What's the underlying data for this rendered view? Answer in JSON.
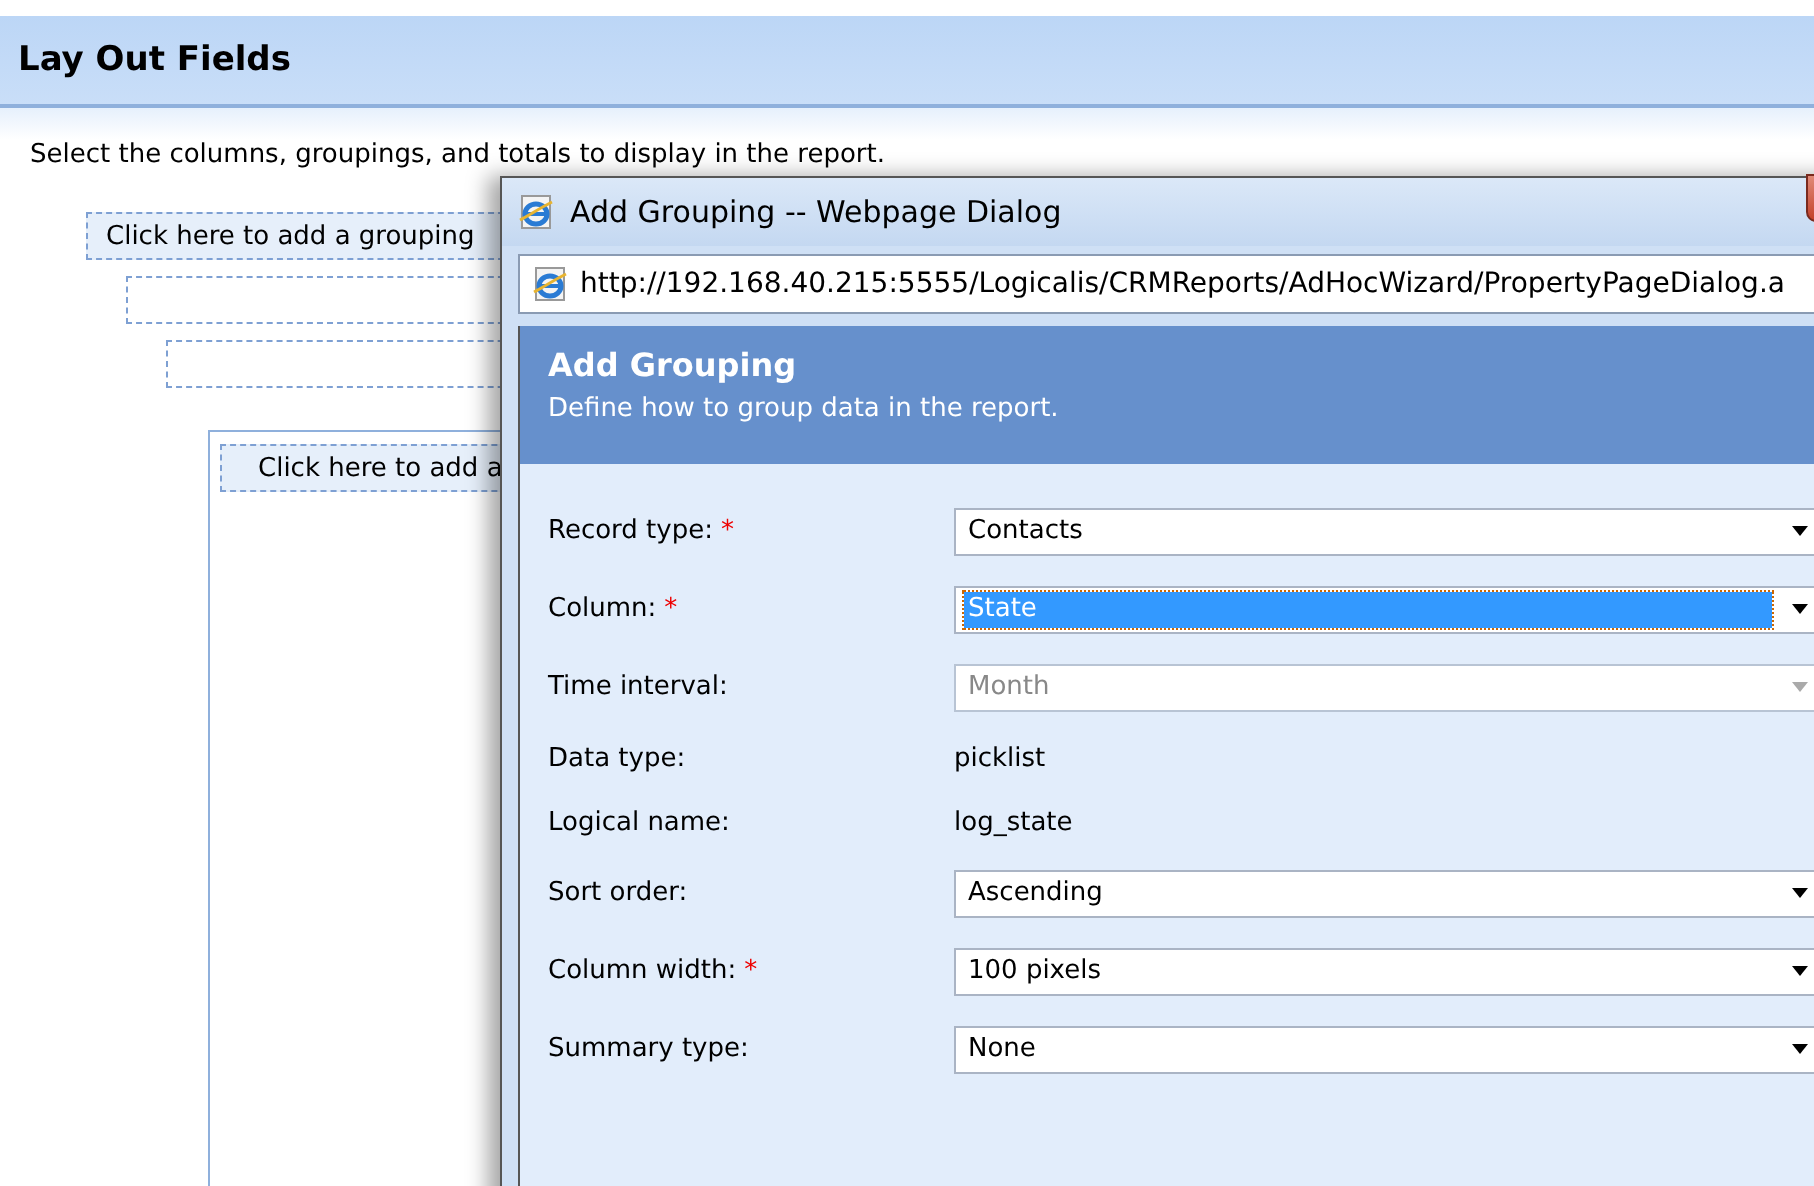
{
  "page": {
    "title": "Lay Out Fields",
    "instruction": "Select the columns, groupings, and totals to display in the report.",
    "groupings": [
      {
        "kind": "button",
        "label": "Click here to add a grouping"
      },
      {
        "kind": "slot"
      },
      {
        "kind": "slot"
      }
    ],
    "table_grouping": "Click here to add a"
  },
  "dialog": {
    "title": "Add Grouping -- Webpage Dialog",
    "address": "http://192.168.40.215:5555/Logicalis/CRMReports/AdHocWizard/PropertyPageDialog.a",
    "header": {
      "title": "Add Grouping",
      "subtitle": "Define how to group data in the report."
    },
    "fields": [
      {
        "kind": "select",
        "label": "Record type:",
        "required_mark": "*",
        "value": "Contacts",
        "selected": false,
        "disabled": false
      },
      {
        "kind": "select",
        "label": "Column:",
        "required_mark": "*",
        "value": "State",
        "selected": true,
        "disabled": false
      },
      {
        "kind": "select",
        "label": "Time interval:",
        "value": "Month",
        "selected": false,
        "disabled": true
      },
      {
        "kind": "text",
        "label": "Data type:",
        "value": "picklist"
      },
      {
        "kind": "text",
        "label": "Logical name:",
        "value": "log_state"
      },
      {
        "kind": "select",
        "label": "Sort order:",
        "value": "Ascending",
        "selected": false,
        "disabled": false
      },
      {
        "kind": "select",
        "label": "Column width:",
        "required_mark": "*",
        "value": "100 pixels",
        "selected": false,
        "disabled": false
      },
      {
        "kind": "select",
        "label": "Summary type:",
        "value": "None",
        "selected": false,
        "disabled": false
      }
    ]
  }
}
